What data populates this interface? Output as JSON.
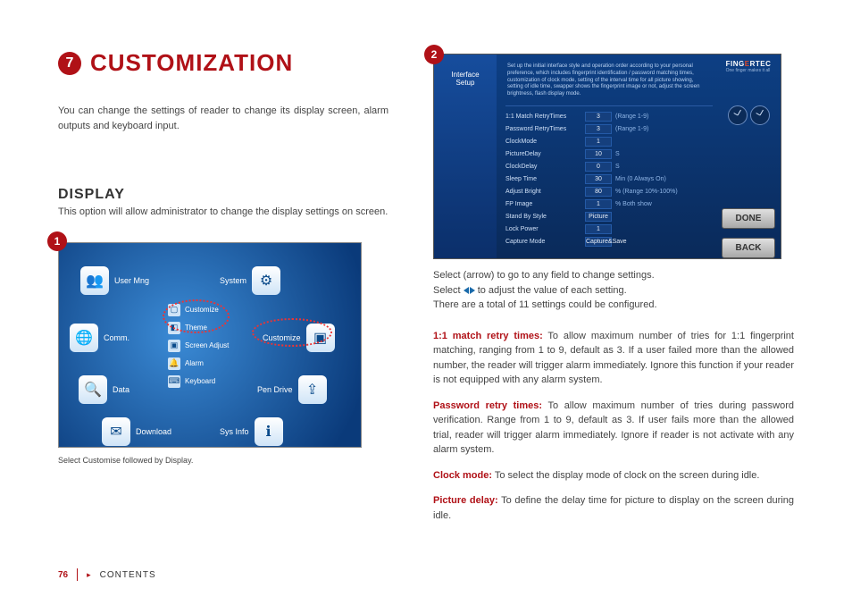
{
  "chapter": {
    "number": "7",
    "title": "CUSTOMIZATION"
  },
  "intro": "You can change the settings of reader to change its display screen, alarm outputs and keyboard input.",
  "display": {
    "heading": "DISPLAY",
    "text": "This option will allow administrator to change the display settings on screen."
  },
  "screenshot1": {
    "step": "1",
    "menu": {
      "user_mng": "User Mng",
      "system": "System",
      "comm": "Comm.",
      "customize": "Customize",
      "data": "Data",
      "pen_drive": "Pen Drive",
      "download": "Download",
      "sys_info": "Sys Info"
    },
    "submenu": {
      "customize": "Customize",
      "theme": "Theme",
      "screen_adjust": "Screen Adjust",
      "alarm": "Alarm",
      "keyboard": "Keyboard"
    },
    "caption": "Select Customise followed by Display."
  },
  "screenshot2": {
    "step": "2",
    "sidebar_title_line1": "Interface",
    "sidebar_title_line2": "Setup",
    "desc": "Set up the initial interface style and operation order according to your personal preference, which includes fingerprint identification / password matching times, customization of clock mode, setting of the interval time for all picture showing, setting of idle time, swapper shows the fingerprint image or not, adjust the screen brightness, flash display mode.",
    "rows": [
      {
        "label": "1:1 Match RetryTimes",
        "val": "3",
        "note": "(Range 1-9)"
      },
      {
        "label": "Password RetryTimes",
        "val": "3",
        "note": "(Range 1-9)"
      },
      {
        "label": "ClockMode",
        "val": "1",
        "note": ""
      },
      {
        "label": "PictureDelay",
        "val": "10",
        "note": "S"
      },
      {
        "label": "ClockDelay",
        "val": "0",
        "note": "S"
      },
      {
        "label": "Sleep Time",
        "val": "30",
        "note": "Min (0 Always On)"
      },
      {
        "label": "Adjust Bright",
        "val": "80",
        "note": "% (Range 10%-100%)"
      },
      {
        "label": "FP Image",
        "val": "1",
        "note": "% Both show"
      },
      {
        "label": "Stand By Style",
        "val": "Picture",
        "note": ""
      },
      {
        "label": "Lock Power",
        "val": "1",
        "note": ""
      },
      {
        "label": "Capture Mode",
        "val": "Capture&Save",
        "note": ""
      }
    ],
    "brand": "FINGERTEC",
    "tagline": "One finger makes it all",
    "done": "DONE",
    "back": "BACK"
  },
  "select_lines": {
    "line1": "Select (arrow) to go to any field to change settings.",
    "line2a": "Select ",
    "line2b": " to adjust the value of each setting.",
    "line3": "There are a total of 11 settings could be configured."
  },
  "paragraphs": {
    "p1": {
      "label": "1:1 match retry times:",
      "text": " To allow maximum number of tries for 1:1 fingerprint matching, ranging from 1 to 9, default as 3. If a user failed more than the allowed number, the reader will trigger alarm immediately. Ignore this function if your reader is not equipped with any alarm system."
    },
    "p2": {
      "label": "Password retry times:",
      "text": " To allow maximum number of tries during password verification. Range from 1 to 9, default as 3. If user fails more than the allowed trial, reader will trigger alarm immediately. Ignore if reader is not activate with any alarm system."
    },
    "p3": {
      "label": "Clock mode:",
      "text": " To select the display mode of clock on the screen during idle."
    },
    "p4": {
      "label": "Picture delay:",
      "text": " To define the delay time for picture to display on the screen during idle."
    }
  },
  "footer": {
    "page": "76",
    "contents": "CONTENTS"
  }
}
